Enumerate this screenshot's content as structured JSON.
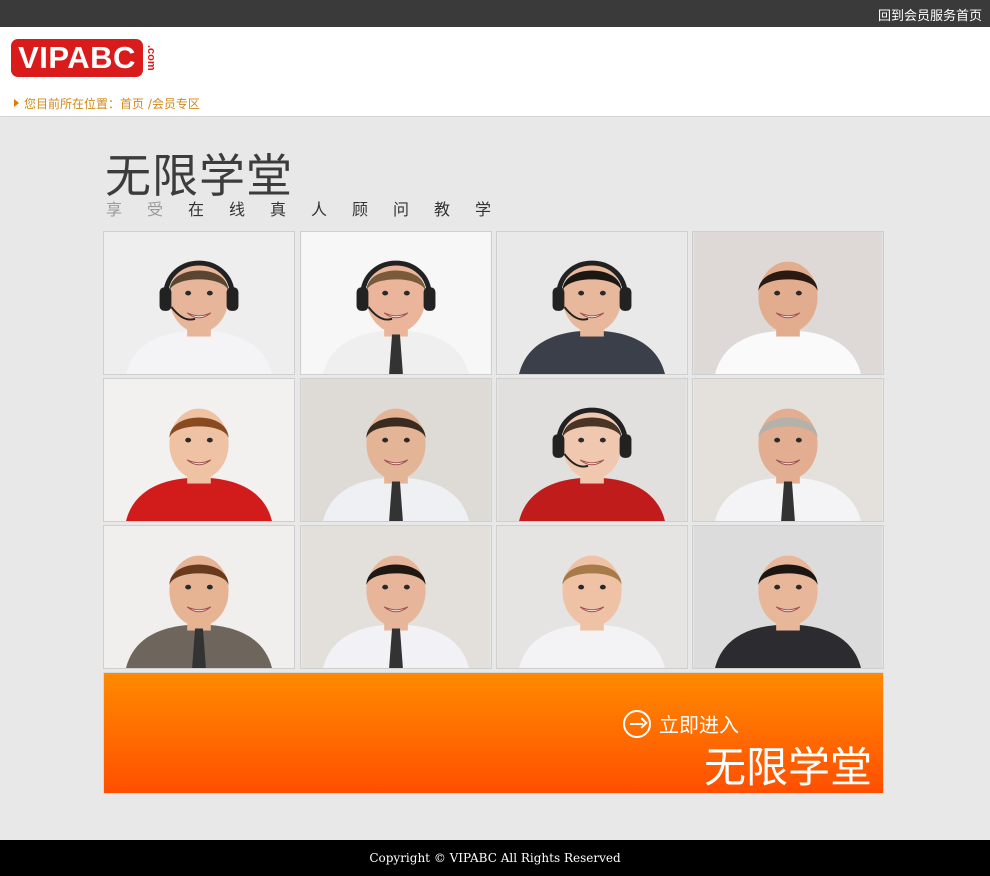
{
  "topbar": {
    "link": "回到会员服务首页"
  },
  "logo": {
    "text": "VIPABC",
    "suffix": ".com"
  },
  "breadcrumb": {
    "prefix": "您目前所在位置：",
    "home": "首页",
    "sep": " /",
    "current": "会员专区"
  },
  "hero": {
    "title": "无限学堂",
    "subtitle_chars": [
      "享",
      "受",
      "在",
      "线",
      "真",
      "人",
      "顾",
      "问",
      "教",
      "学"
    ]
  },
  "photos": [
    {
      "bg": "#eeeeee",
      "skin": "#e7b69a",
      "hair": "#5a4630",
      "shirt": "#f4f4f6",
      "headset": true,
      "tie": false
    },
    {
      "bg": "#f7f7f7",
      "skin": "#eab59a",
      "hair": "#7a5a3a",
      "shirt": "#efefef",
      "headset": true,
      "tie": true
    },
    {
      "bg": "#e9e9e9",
      "skin": "#e8b89c",
      "hair": "#1d1713",
      "shirt": "#3a3f4a",
      "headset": true,
      "tie": false
    },
    {
      "bg": "#ded9d6",
      "skin": "#e2ad8e",
      "hair": "#2a1a12",
      "shirt": "#fafafa",
      "headset": false,
      "tie": false
    },
    {
      "bg": "#f3f1f0",
      "skin": "#efc2a4",
      "hair": "#8a4a20",
      "shirt": "#d21c1c",
      "headset": false,
      "tie": false
    },
    {
      "bg": "#dedad6",
      "skin": "#e4b497",
      "hair": "#3a2a1f",
      "shirt": "#eef0f4",
      "headset": false,
      "tie": true
    },
    {
      "bg": "#e2e0de",
      "skin": "#f0c8b0",
      "hair": "#4a3426",
      "shirt": "#c01c1c",
      "headset": true,
      "tie": false
    },
    {
      "bg": "#e4e0dc",
      "skin": "#e2ad90",
      "hair": "#b4b0aa",
      "shirt": "#f4f4f6",
      "headset": false,
      "tie": true
    },
    {
      "bg": "#f1efed",
      "skin": "#e6b393",
      "hair": "#6a3a1e",
      "shirt": "#6e665c",
      "headset": false,
      "tie": true
    },
    {
      "bg": "#e3e0dc",
      "skin": "#e6b59a",
      "hair": "#1f1712",
      "shirt": "#f2f2f6",
      "headset": false,
      "tie": true
    },
    {
      "bg": "#e6e4e2",
      "skin": "#efc2a5",
      "hair": "#a77a4a",
      "shirt": "#f3f3f6",
      "headset": false,
      "tie": false
    },
    {
      "bg": "#dddcdc",
      "skin": "#e8b699",
      "hair": "#1c1612",
      "shirt": "#2c2c30",
      "headset": false,
      "tie": false
    }
  ],
  "banner": {
    "enter_label": "立即进入",
    "title": "无限学堂"
  },
  "footer": {
    "copyright": "Copyright © VIPABC All Rights Reserved"
  }
}
